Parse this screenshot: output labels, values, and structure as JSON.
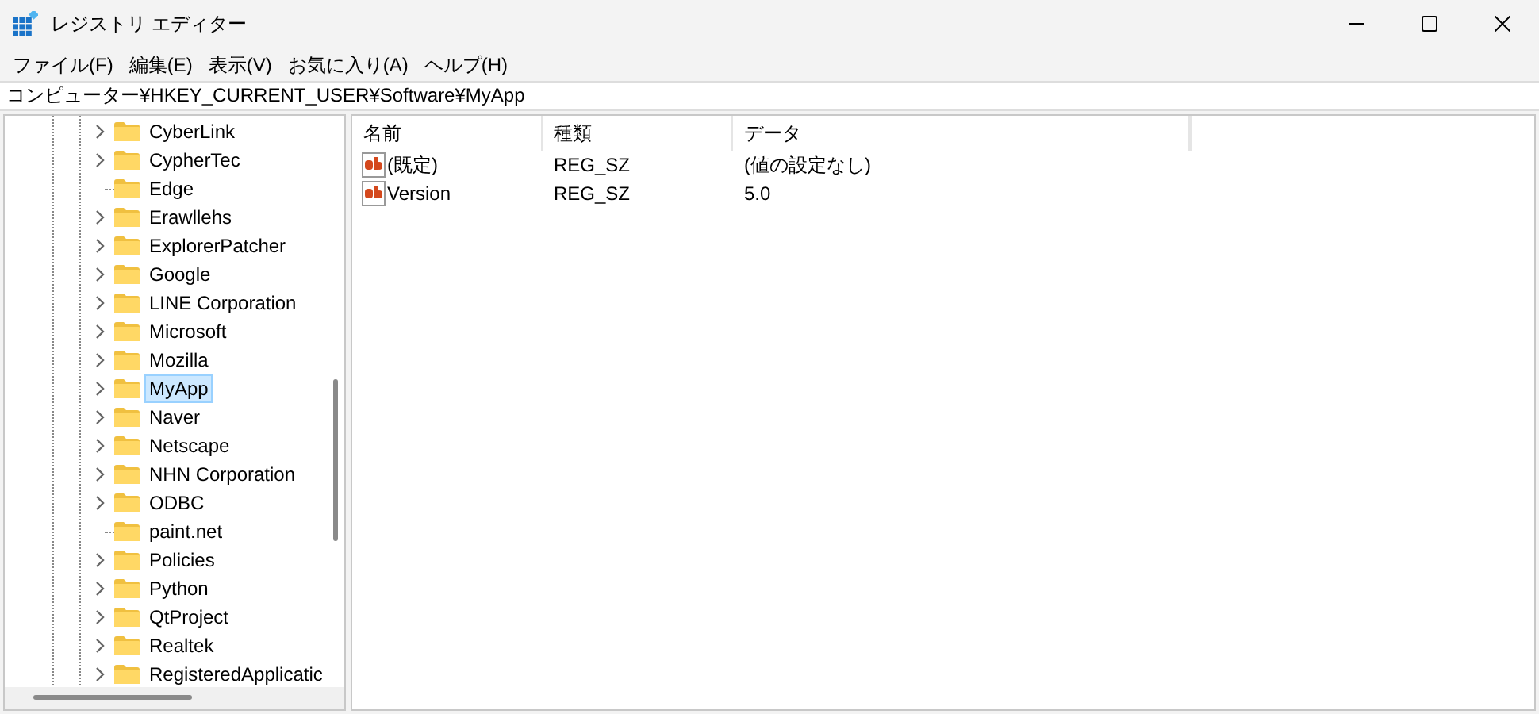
{
  "window": {
    "title": "レジストリ エディター"
  },
  "menu": [
    "ファイル(F)",
    "編集(E)",
    "表示(V)",
    "お気に入り(A)",
    "ヘルプ(H)"
  ],
  "address": "コンピューター¥HKEY_CURRENT_USER¥Software¥MyApp",
  "tree": [
    {
      "label": "CyberLink",
      "expandable": true,
      "selected": false
    },
    {
      "label": "CypherTec",
      "expandable": true,
      "selected": false
    },
    {
      "label": "Edge",
      "expandable": false,
      "selected": false
    },
    {
      "label": "Erawllehs",
      "expandable": true,
      "selected": false
    },
    {
      "label": "ExplorerPatcher",
      "expandable": true,
      "selected": false
    },
    {
      "label": "Google",
      "expandable": true,
      "selected": false
    },
    {
      "label": "LINE Corporation",
      "expandable": true,
      "selected": false
    },
    {
      "label": "Microsoft",
      "expandable": true,
      "selected": false
    },
    {
      "label": "Mozilla",
      "expandable": true,
      "selected": false
    },
    {
      "label": "MyApp",
      "expandable": true,
      "selected": true
    },
    {
      "label": "Naver",
      "expandable": true,
      "selected": false
    },
    {
      "label": "Netscape",
      "expandable": true,
      "selected": false
    },
    {
      "label": "NHN Corporation",
      "expandable": true,
      "selected": false
    },
    {
      "label": "ODBC",
      "expandable": true,
      "selected": false
    },
    {
      "label": "paint.net",
      "expandable": false,
      "selected": false
    },
    {
      "label": "Policies",
      "expandable": true,
      "selected": false
    },
    {
      "label": "Python",
      "expandable": true,
      "selected": false
    },
    {
      "label": "QtProject",
      "expandable": true,
      "selected": false
    },
    {
      "label": "Realtek",
      "expandable": true,
      "selected": false
    },
    {
      "label": "RegisteredApplicatic",
      "expandable": true,
      "selected": false
    }
  ],
  "table": {
    "columns": [
      "名前",
      "種類",
      "データ"
    ],
    "rows": [
      [
        "(既定)",
        "REG_SZ",
        "(値の設定なし)"
      ],
      [
        "Version",
        "REG_SZ",
        "5.0"
      ]
    ]
  }
}
